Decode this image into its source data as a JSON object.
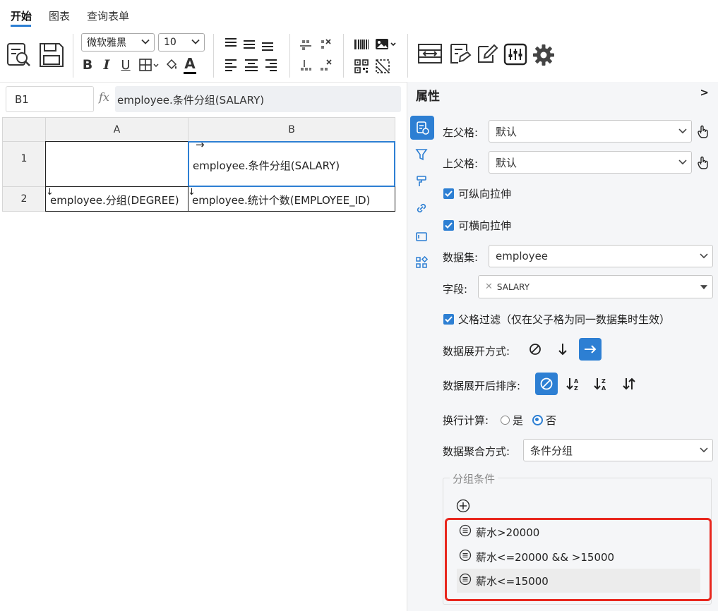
{
  "tabs": [
    "开始",
    "图表",
    "查询表单"
  ],
  "toolbar": {
    "font_family": "微软雅黑",
    "font_size": "10",
    "bold": "B",
    "italic": "I",
    "underline": "U",
    "font_color_letter": "A"
  },
  "formula_bar": {
    "cell_ref": "B1",
    "fx": "fx",
    "formula": "employee.条件分组(SALARY)"
  },
  "grid": {
    "columns": [
      "A",
      "B"
    ],
    "rows": [
      "1",
      "2"
    ],
    "b1_arrow": "→",
    "b1": "employee.条件分组(SALARY)",
    "a2_arrow": "↓",
    "a2": "employee.分组(DEGREE)",
    "b2_arrow": "↓",
    "b2": "employee.统计个数(EMPLOYEE_ID)"
  },
  "panel": {
    "title": "属性",
    "collapse": ">",
    "left_parent_label": "左父格:",
    "left_parent_value": "默认",
    "top_parent_label": "上父格:",
    "top_parent_value": "默认",
    "stretch_v": "可纵向拉伸",
    "stretch_h": "可横向拉伸",
    "dataset_label": "数据集:",
    "dataset_value": "employee",
    "field_label": "字段:",
    "field_tag": "SALARY",
    "parent_filter": "父格过滤（仅在父子格为同一数据集时生效）",
    "expand_label": "数据展开方式:",
    "sort_label": "数据展开后排序:",
    "wrap_label": "换行计算:",
    "wrap_yes": "是",
    "wrap_no": "否",
    "agg_label": "数据聚合方式:",
    "agg_value": "条件分组",
    "group_legend": "分组条件",
    "conditions": [
      "薪水>20000",
      "薪水<=20000 && >15000",
      "薪水<=15000"
    ]
  },
  "colors": {
    "accent": "#2d7fd3",
    "highlight": "#e8271e"
  }
}
